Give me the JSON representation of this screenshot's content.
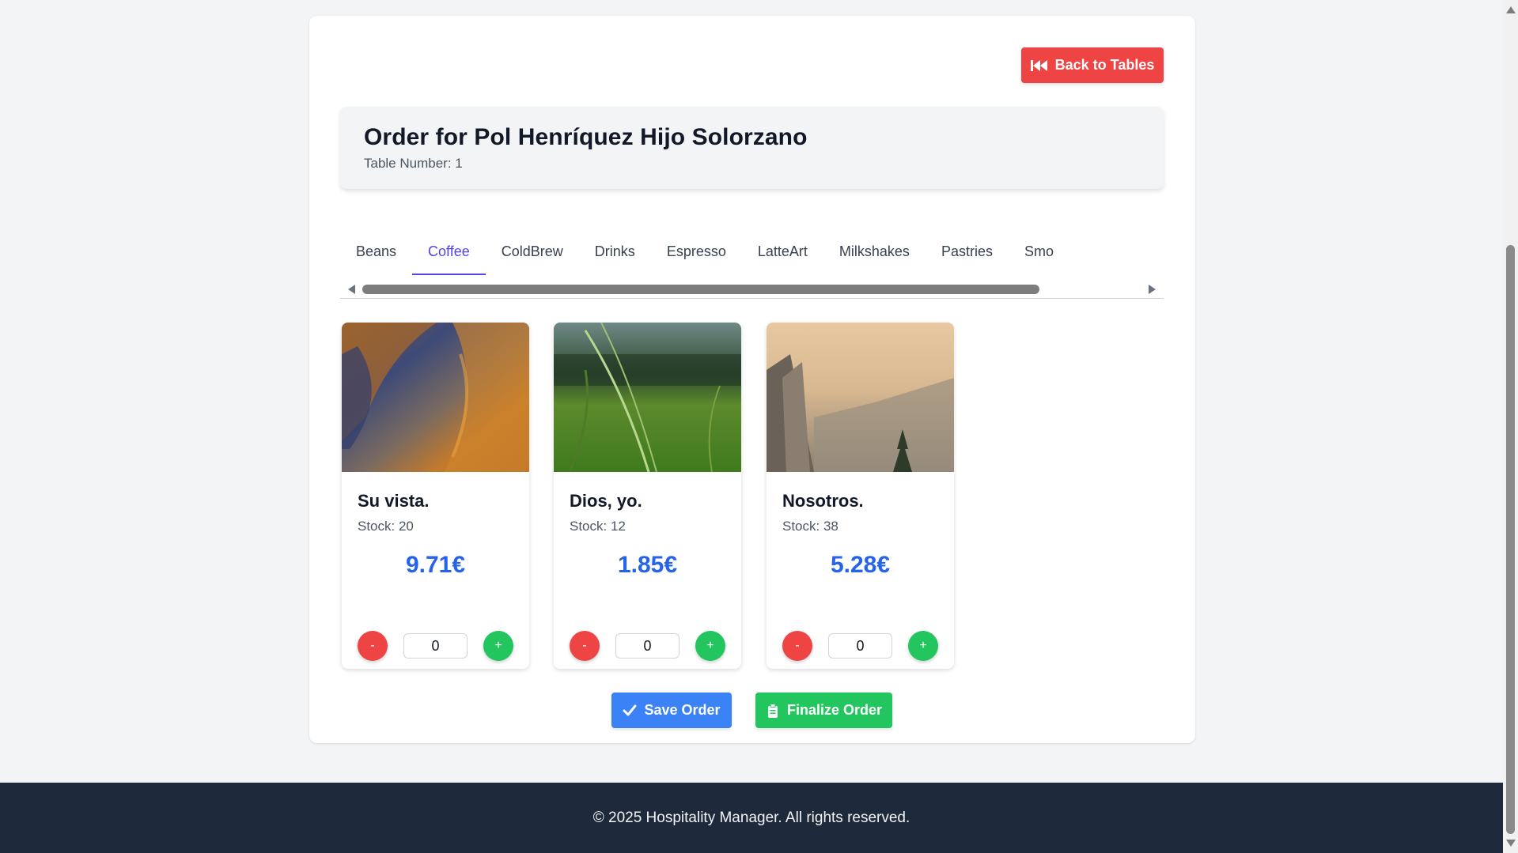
{
  "header": {
    "back_label": "Back to Tables",
    "order_title": "Order for Pol Henríquez Hijo Solorzano",
    "table_number": "Table Number: 1"
  },
  "tabs": [
    {
      "label": "Beans",
      "active": false
    },
    {
      "label": "Coffee",
      "active": true
    },
    {
      "label": "ColdBrew",
      "active": false
    },
    {
      "label": "Drinks",
      "active": false
    },
    {
      "label": "Espresso",
      "active": false
    },
    {
      "label": "LatteArt",
      "active": false
    },
    {
      "label": "Milkshakes",
      "active": false
    },
    {
      "label": "Pastries",
      "active": false
    },
    {
      "label": "Smo",
      "active": false
    }
  ],
  "products": [
    {
      "name": "Su vista.",
      "stock": "Stock: 20",
      "price": "9.71€",
      "qty": "0",
      "minus": "-",
      "plus": "+"
    },
    {
      "name": "Dios, yo.",
      "stock": "Stock: 12",
      "price": "1.85€",
      "qty": "0",
      "minus": "-",
      "plus": "+"
    },
    {
      "name": "Nosotros.",
      "stock": "Stock: 38",
      "price": "5.28€",
      "qty": "0",
      "minus": "-",
      "plus": "+"
    }
  ],
  "actions": {
    "save_label": "Save Order",
    "finalize_label": "Finalize Order"
  },
  "footer": {
    "text": "© 2025 Hospitality Manager. All rights reserved."
  },
  "icons": {
    "back": "backward-icon",
    "save": "check-icon",
    "finalize": "clipboard-icon"
  },
  "colors": {
    "danger": "#ef4444",
    "success": "#22c55e",
    "primary": "#3b82f6",
    "price": "#2563eb",
    "active_tab": "#4f46e5",
    "footer_bg": "#1e293b"
  }
}
